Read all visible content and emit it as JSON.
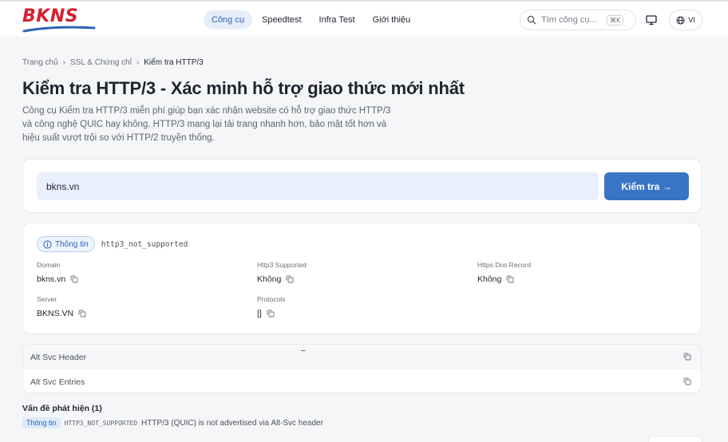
{
  "brand": {
    "logo_text": "BKNS",
    "logo_color": "#d3202f",
    "swoosh_color": "#2d63b8"
  },
  "nav": {
    "items": [
      {
        "label": "Công cụ",
        "active": true
      },
      {
        "label": "Speedtest",
        "active": false
      },
      {
        "label": "Infra Test",
        "active": false
      },
      {
        "label": "Giới thiệu",
        "active": false
      }
    ]
  },
  "search": {
    "placeholder": "Tìm công cụ...",
    "shortcut": "⌘K"
  },
  "lang": {
    "label": "VI"
  },
  "breadcrumb": {
    "home": "Trang chủ",
    "category": "SSL & Chứng chỉ",
    "current": "Kiểm tra HTTP/3"
  },
  "page": {
    "title": "Kiểm tra HTTP/3 - Xác minh hỗ trợ giao thức mới nhất",
    "description": "Công cụ Kiểm tra HTTP/3 miễn phí giúp bạn xác nhận website có hỗ trợ giao thức HTTP/3 và công nghệ QUIC hay không. HTTP/3 mang lại tải trang nhanh hơn, bảo mật tốt hơn và hiệu suất vượt trội so với HTTP/2 truyền thống."
  },
  "form": {
    "url_value": "bkns.vn",
    "submit_label": "Kiểm tra →"
  },
  "result": {
    "status_label": "Thông tin",
    "status_code": "http3_not_supported",
    "fields": {
      "domain": {
        "label": "Domain",
        "value": "bkns.vn"
      },
      "http3_supported": {
        "label": "Http3 Supported",
        "value": "Không"
      },
      "https_dns_record": {
        "label": "Https Dns Record",
        "value": "Không"
      },
      "server": {
        "label": "Server",
        "value": "BKNS.VN"
      },
      "protocols": {
        "label": "Protocols",
        "value": "[]"
      }
    }
  },
  "table": {
    "rows": [
      {
        "label": "Alt Svc Header",
        "value": "–"
      },
      {
        "label": "Alt Svc Entries",
        "value": ""
      }
    ]
  },
  "issues": {
    "title": "Vấn đề phát hiện (1)",
    "items": [
      {
        "badge": "Thông tin",
        "code": "HTTP3_NOT_SUPPORTED",
        "message": "HTTP/3 (QUIC) is not advertised via Alt-Svc header"
      }
    ]
  },
  "colors": {
    "accent": "#3a74c4",
    "nav_active_bg": "#e6eefb",
    "input_bg": "#e9f0fb"
  }
}
